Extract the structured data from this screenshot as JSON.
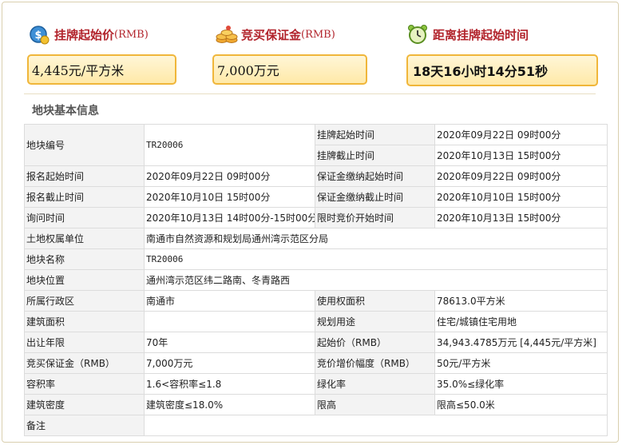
{
  "summary": {
    "start_price": {
      "title": "挂牌起始价",
      "unit": "(RMB)",
      "value": "4,445元/平方米"
    },
    "deposit": {
      "title": "竞买保证金",
      "unit": "(RMB)",
      "value": "7,000万元"
    },
    "countdown": {
      "title": "距离挂牌起始时间",
      "value": "18天16小时14分51秒"
    }
  },
  "section_title": "地块基本信息",
  "rows": {
    "r1": {
      "label": "地块编号",
      "value": "TR20006",
      "sub1_label": "挂牌起始时间",
      "sub1_value": "2020年09月22日 09时00分",
      "sub2_label": "挂牌截止时间",
      "sub2_value": "2020年10月13日 15时00分"
    },
    "r2": {
      "l1": "报名起始时间",
      "v1": "2020年09月22日 09时00分",
      "l2": "保证金缴纳起始时间",
      "v2": "2020年09月22日 09时00分"
    },
    "r3": {
      "l1": "报名截止时间",
      "v1": "2020年10月10日 15时00分",
      "l2": "保证金缴纳截止时间",
      "v2": "2020年10月10日 15时00分"
    },
    "r4": {
      "l1": "询问时间",
      "v1": "2020年10月13日 14时00分-15时00分",
      "l2": "限时竞价开始时间",
      "v2": "2020年10月13日 15时00分"
    },
    "r5": {
      "l1": "土地权属单位",
      "v1": "南通市自然资源和规划局通州湾示范区分局"
    },
    "r6": {
      "l1": "地块名称",
      "v1": "TR20006"
    },
    "r7": {
      "l1": "地块位置",
      "v1": "通州湾示范区纬二路南、冬青路西"
    },
    "r8": {
      "l1": "所属行政区",
      "v1": "南通市",
      "l2": "使用权面积",
      "v2": "78613.0平方米"
    },
    "r9": {
      "l1": "建筑面积",
      "v1": "",
      "l2": "规划用途",
      "v2": "住宅/城镇住宅用地"
    },
    "r10": {
      "l1": "出让年限",
      "v1": "70年",
      "l2": "起始价（RMB）",
      "v2": "34,943.4785万元 [4,445元/平方米]"
    },
    "r11": {
      "l1": "竞买保证金（RMB）",
      "v1": "7,000万元",
      "l2": "竞价增价幅度（RMB）",
      "v2": "50元/平方米"
    },
    "r12": {
      "l1": "容积率",
      "v1": "1.6<容积率≤1.8",
      "l2": "绿化率",
      "v2": "35.0%≤绿化率"
    },
    "r13": {
      "l1": "建筑密度",
      "v1": "建筑密度≤18.0%",
      "l2": "限高",
      "v2": "限高≤50.0米"
    },
    "r14": {
      "l1": "备注",
      "v1": ""
    }
  },
  "colors": {
    "accent_red": "#b2242c",
    "box_border": "#f0b63a",
    "box_fill": "#ffeeb8"
  }
}
